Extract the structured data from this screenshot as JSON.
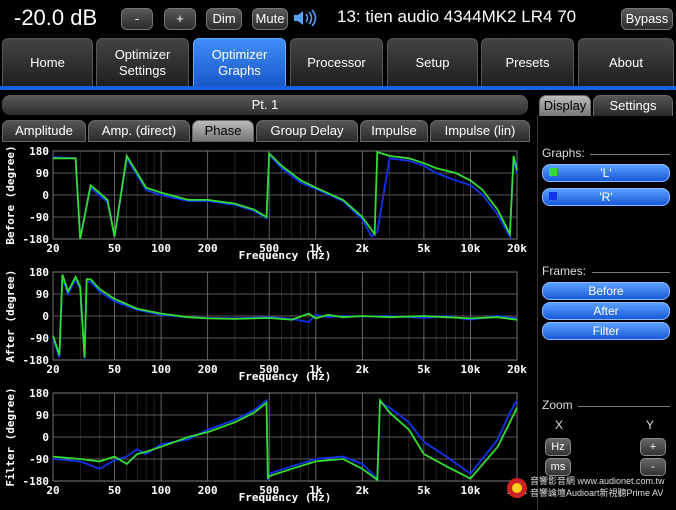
{
  "topbar": {
    "volume": "-20.0 dB",
    "minus": "-",
    "plus": "+",
    "dim": "Dim",
    "mute": "Mute",
    "speaker_icon": "speaker-icon",
    "preset_title": "13: tien audio 4344MK2 LR4 70",
    "bypass": "Bypass"
  },
  "main_tabs": [
    {
      "label": "Home"
    },
    {
      "label": "Optimizer\nSettings"
    },
    {
      "label": "Optimizer\nGraphs"
    },
    {
      "label": "Processor"
    },
    {
      "label": "Setup"
    },
    {
      "label": "Presets"
    },
    {
      "label": "About"
    }
  ],
  "graph_panel": {
    "header": "Pt. 1",
    "tabs": [
      "Amplitude",
      "Amp. (direct)",
      "Phase",
      "Group Delay",
      "Impulse",
      "Impulse (lin)"
    ],
    "active_tab": "Phase"
  },
  "side_tabs": [
    "Display",
    "Settings"
  ],
  "side": {
    "graphs_label": "Graphs:",
    "graph_buttons": [
      {
        "label": "'L'",
        "color": "#33dd33"
      },
      {
        "label": "'R'",
        "color": "#1133ee"
      }
    ],
    "frames_label": "Frames:",
    "frame_buttons": [
      "Before",
      "After",
      "Filter"
    ],
    "zoom_label": "Zoom",
    "zoom_x": "X",
    "zoom_y": "Y",
    "zoom_hz": "Hz",
    "zoom_ms": "ms",
    "zoom_plus": "+",
    "zoom_minus": "-"
  },
  "watermark": {
    "line1": "音響影音網 www.audionet.com.tw",
    "line2": "音響論壇Audioart新視聽Prime AV"
  },
  "colors": {
    "series_L": "#33dd33",
    "series_R": "#1133ee",
    "accent": "#1e5fe0"
  },
  "chart_data": [
    {
      "type": "line",
      "ylabel": "Before (degree)",
      "xlabel": "Frequency (Hz)",
      "x_scale": "log",
      "xlim": [
        20,
        20000
      ],
      "ylim": [
        -180,
        180
      ],
      "x_ticks": [
        "20",
        "50",
        "100",
        "200",
        "500",
        "1k",
        "2k",
        "5k",
        "10k",
        "20k"
      ],
      "y_ticks": [
        "180",
        "90",
        "0",
        "-90",
        "-180"
      ],
      "grid": true,
      "series": [
        {
          "name": "'L'",
          "x": [
            20,
            28,
            30,
            35,
            45,
            50,
            60,
            80,
            100,
            150,
            200,
            300,
            400,
            480,
            500,
            600,
            800,
            1000,
            1500,
            2000,
            2400,
            2500,
            3000,
            4000,
            5000,
            6000,
            8000,
            10000,
            12000,
            15000,
            18000,
            19000,
            20000
          ],
          "y": [
            150,
            150,
            -180,
            40,
            -20,
            -170,
            160,
            30,
            10,
            -20,
            -20,
            -35,
            -60,
            -90,
            170,
            120,
            60,
            30,
            -20,
            -90,
            -160,
            175,
            160,
            150,
            130,
            110,
            90,
            60,
            20,
            -60,
            -160,
            160,
            100
          ]
        },
        {
          "name": "'R'",
          "x": [
            20,
            28,
            30,
            35,
            45,
            50,
            60,
            80,
            100,
            150,
            200,
            300,
            400,
            480,
            500,
            600,
            800,
            1000,
            1500,
            2000,
            2300,
            2500,
            3000,
            4000,
            5000,
            6000,
            8000,
            10000,
            12000,
            15000,
            18000,
            19000,
            20000
          ],
          "y": [
            155,
            150,
            -175,
            30,
            -30,
            -170,
            150,
            20,
            0,
            -25,
            -25,
            -40,
            -65,
            -95,
            165,
            110,
            50,
            25,
            -25,
            -100,
            -170,
            -150,
            150,
            140,
            120,
            90,
            60,
            40,
            0,
            -80,
            -170,
            150,
            90
          ]
        }
      ]
    },
    {
      "type": "line",
      "ylabel": "After (degree)",
      "xlabel": "Frequency (Hz)",
      "x_scale": "log",
      "xlim": [
        20,
        20000
      ],
      "ylim": [
        -180,
        180
      ],
      "x_ticks": [
        "20",
        "50",
        "100",
        "200",
        "500",
        "1k",
        "2k",
        "5k",
        "10k",
        "20k"
      ],
      "y_ticks": [
        "180",
        "90",
        "0",
        "-90",
        "-180"
      ],
      "grid": true,
      "series": [
        {
          "name": "'L'",
          "x": [
            20,
            22,
            23,
            25,
            28,
            30,
            32,
            33,
            35,
            40,
            50,
            70,
            100,
            150,
            200,
            300,
            500,
            700,
            900,
            1000,
            1200,
            1500,
            2000,
            3000,
            5000,
            7000,
            10000,
            15000,
            20000
          ],
          "y": [
            -80,
            -160,
            170,
            100,
            160,
            120,
            -170,
            150,
            150,
            110,
            70,
            30,
            10,
            -5,
            -10,
            -12,
            -8,
            -15,
            10,
            -10,
            5,
            -5,
            0,
            -5,
            0,
            -5,
            -10,
            -5,
            -15
          ]
        },
        {
          "name": "'R'",
          "x": [
            20,
            22,
            23,
            25,
            28,
            30,
            32,
            33,
            35,
            40,
            50,
            70,
            100,
            150,
            200,
            300,
            500,
            700,
            900,
            1000,
            1200,
            1500,
            2000,
            3000,
            5000,
            7000,
            10000,
            15000,
            20000
          ],
          "y": [
            -90,
            -170,
            160,
            90,
            150,
            110,
            -175,
            140,
            140,
            100,
            60,
            25,
            5,
            -5,
            -8,
            -10,
            -5,
            -12,
            -25,
            5,
            -5,
            0,
            -2,
            0,
            -8,
            0,
            -15,
            0,
            -10
          ]
        }
      ]
    },
    {
      "type": "line",
      "ylabel": "Filter (degree)",
      "xlabel": "Frequency (Hz)",
      "x_scale": "log",
      "xlim": [
        20,
        20000
      ],
      "ylim": [
        -180,
        180
      ],
      "x_ticks": [
        "20",
        "50",
        "100",
        "200",
        "500",
        "1k",
        "2k",
        "5k",
        "10k",
        "20k"
      ],
      "y_ticks": [
        "180",
        "90",
        "0",
        "-90",
        "-180"
      ],
      "grid": true,
      "series": [
        {
          "name": "'L'",
          "x": [
            20,
            30,
            40,
            50,
            60,
            70,
            80,
            100,
            150,
            200,
            300,
            400,
            480,
            490,
            500,
            700,
            1000,
            1500,
            2000,
            2500,
            2600,
            3000,
            4000,
            5000,
            7000,
            10000,
            15000,
            18000,
            20000
          ],
          "y": [
            -80,
            -90,
            -100,
            -80,
            -110,
            -70,
            -60,
            -40,
            0,
            20,
            60,
            100,
            140,
            -170,
            -160,
            -130,
            -100,
            -90,
            -130,
            -175,
            150,
            100,
            30,
            -70,
            -120,
            -170,
            -40,
            60,
            120
          ]
        },
        {
          "name": "'R'",
          "x": [
            20,
            30,
            40,
            50,
            60,
            70,
            80,
            100,
            150,
            200,
            300,
            400,
            480,
            490,
            500,
            700,
            1000,
            1500,
            2000,
            2500,
            2600,
            3000,
            4000,
            5000,
            7000,
            10000,
            15000,
            18000,
            20000
          ],
          "y": [
            -90,
            -100,
            -130,
            -95,
            -80,
            -50,
            -70,
            -30,
            -10,
            30,
            70,
            110,
            150,
            -175,
            -150,
            -120,
            -90,
            -80,
            -110,
            -170,
            140,
            120,
            60,
            -20,
            -80,
            -150,
            -10,
            100,
            150
          ]
        }
      ]
    }
  ]
}
